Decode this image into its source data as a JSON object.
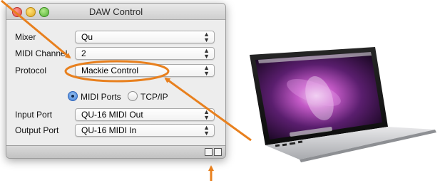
{
  "window": {
    "title": "DAW Control"
  },
  "fields": [
    {
      "label": "Mixer",
      "value": "Qu"
    },
    {
      "label": "MIDI Channel",
      "value": "2"
    },
    {
      "label": "Protocol",
      "value": "Mackie Control"
    },
    {
      "label": "Input Port",
      "value": "QU-16 MIDI Out"
    },
    {
      "label": "Output Port",
      "value": "QU-16 MIDI In"
    }
  ],
  "port_type": {
    "options": [
      "MIDI Ports",
      "TCP/IP"
    ],
    "selected": "MIDI Ports"
  },
  "colors": {
    "annotation_orange": "#e8801e",
    "radio_selected": "#3c7ad6",
    "window_bg": "#ededed"
  }
}
